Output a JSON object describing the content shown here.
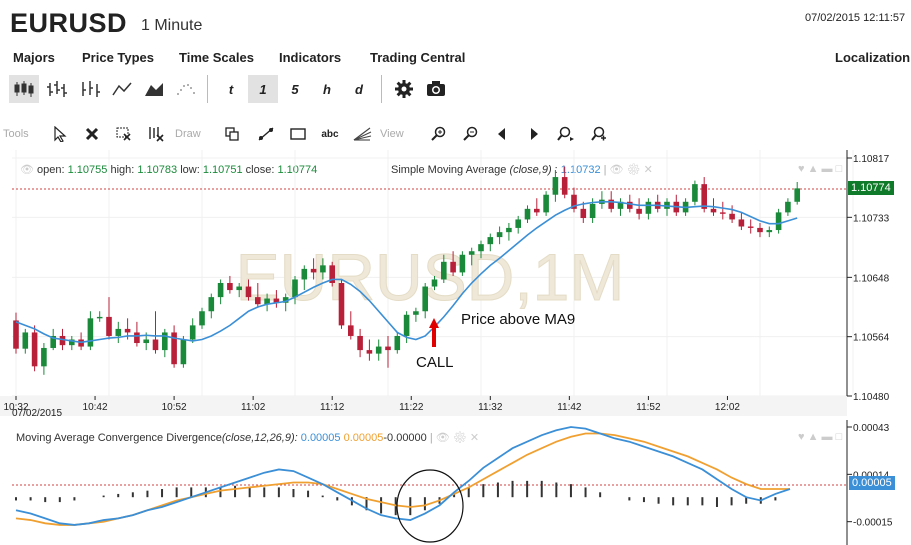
{
  "header": {
    "title": "EURUSD",
    "subtitle": "1 Minute",
    "datetime": "07/02/2015 12:11:57"
  },
  "menu": {
    "items": [
      "Majors",
      "Price Types",
      "Time Scales",
      "Indicators",
      "Trading Central"
    ],
    "right": "Localization"
  },
  "toolbar": {
    "timescales": [
      "t",
      "1",
      "5",
      "h",
      "d"
    ],
    "selected_timescale": "1"
  },
  "tools": {
    "tools_label": "Tools",
    "draw_label": "Draw",
    "view_label": "View",
    "text_tool": "abc"
  },
  "price_chart": {
    "watermark": "EURUSD,1M",
    "ohlc": {
      "open_label": "open:",
      "open": "1.10755",
      "high_label": "high:",
      "high": "1.10783",
      "low_label": "low:",
      "low": "1.10751",
      "close_label": "close:",
      "close": "1.10774"
    },
    "sma_label": "Simple Moving Average",
    "sma_params": "(close,9)",
    "sma_value": "1.10732",
    "current_price": "1.10774",
    "y_ticks": [
      "1.10817",
      "1.10733",
      "1.10648",
      "1.10564",
      "1.10480"
    ],
    "x_ticks": [
      "10:32",
      "10:42",
      "10:52",
      "11:02",
      "11:12",
      "11:22",
      "11:32",
      "11:42",
      "11:52",
      "12:02"
    ],
    "date_label": "07/02/2015",
    "annotation_price_above": "Price above MA9",
    "annotation_call": "CALL",
    "colors": {
      "up": "#1a8a3a",
      "down": "#b8203a",
      "ma": "#3b8fd6"
    }
  },
  "macd": {
    "label": "Moving Average Convergence Divergence",
    "params": "(close,12,26,9):",
    "v1": "0.00005",
    "v2": "0.00005",
    "v3": "-0.00000",
    "y_ticks": [
      "0.00043",
      "0.00014",
      "-0.00015"
    ],
    "current": "0.00005",
    "colors": {
      "macd": "#3b8fd6",
      "signal": "#f0a030",
      "hist": "#333333"
    }
  },
  "chart_data": {
    "type": "candlestick",
    "candles": [
      {
        "o": 1.10587,
        "h": 1.10598,
        "l": 1.1054,
        "c": 1.10547
      },
      {
        "o": 1.10547,
        "h": 1.10575,
        "l": 1.1054,
        "c": 1.1057
      },
      {
        "o": 1.1057,
        "h": 1.1058,
        "l": 1.10515,
        "c": 1.10522
      },
      {
        "o": 1.10522,
        "h": 1.10555,
        "l": 1.1051,
        "c": 1.10548
      },
      {
        "o": 1.10548,
        "h": 1.10575,
        "l": 1.10545,
        "c": 1.10565
      },
      {
        "o": 1.10565,
        "h": 1.10575,
        "l": 1.10545,
        "c": 1.10552
      },
      {
        "o": 1.10552,
        "h": 1.10565,
        "l": 1.10545,
        "c": 1.1056
      },
      {
        "o": 1.1056,
        "h": 1.1057,
        "l": 1.10545,
        "c": 1.1055
      },
      {
        "o": 1.1055,
        "h": 1.106,
        "l": 1.10545,
        "c": 1.1059
      },
      {
        "o": 1.1059,
        "h": 1.106,
        "l": 1.10585,
        "c": 1.10592
      },
      {
        "o": 1.10592,
        "h": 1.1062,
        "l": 1.1056,
        "c": 1.10565
      },
      {
        "o": 1.10565,
        "h": 1.10585,
        "l": 1.10555,
        "c": 1.10575
      },
      {
        "o": 1.10575,
        "h": 1.1059,
        "l": 1.1056,
        "c": 1.1057
      },
      {
        "o": 1.1057,
        "h": 1.10585,
        "l": 1.1055,
        "c": 1.10555
      },
      {
        "o": 1.10555,
        "h": 1.1057,
        "l": 1.10545,
        "c": 1.1056
      },
      {
        "o": 1.1056,
        "h": 1.106,
        "l": 1.1054,
        "c": 1.10545
      },
      {
        "o": 1.10545,
        "h": 1.10575,
        "l": 1.10535,
        "c": 1.1057
      },
      {
        "o": 1.1057,
        "h": 1.1058,
        "l": 1.1052,
        "c": 1.10525
      },
      {
        "o": 1.10525,
        "h": 1.10565,
        "l": 1.1052,
        "c": 1.1056
      },
      {
        "o": 1.1056,
        "h": 1.1059,
        "l": 1.10555,
        "c": 1.1058
      },
      {
        "o": 1.1058,
        "h": 1.10605,
        "l": 1.10575,
        "c": 1.106
      },
      {
        "o": 1.106,
        "h": 1.10625,
        "l": 1.1059,
        "c": 1.1062
      },
      {
        "o": 1.1062,
        "h": 1.10645,
        "l": 1.1061,
        "c": 1.1064
      },
      {
        "o": 1.1064,
        "h": 1.1065,
        "l": 1.10625,
        "c": 1.1063
      },
      {
        "o": 1.1063,
        "h": 1.1064,
        "l": 1.1062,
        "c": 1.10635
      },
      {
        "o": 1.10635,
        "h": 1.10645,
        "l": 1.10615,
        "c": 1.1062
      },
      {
        "o": 1.1062,
        "h": 1.1064,
        "l": 1.10605,
        "c": 1.1061
      },
      {
        "o": 1.1061,
        "h": 1.10625,
        "l": 1.106,
        "c": 1.10618
      },
      {
        "o": 1.10618,
        "h": 1.1063,
        "l": 1.10605,
        "c": 1.10612
      },
      {
        "o": 1.10612,
        "h": 1.10625,
        "l": 1.106,
        "c": 1.1062
      },
      {
        "o": 1.1062,
        "h": 1.1065,
        "l": 1.1061,
        "c": 1.10645
      },
      {
        "o": 1.10645,
        "h": 1.10665,
        "l": 1.1063,
        "c": 1.1066
      },
      {
        "o": 1.1066,
        "h": 1.10675,
        "l": 1.10645,
        "c": 1.10655
      },
      {
        "o": 1.10655,
        "h": 1.10675,
        "l": 1.10645,
        "c": 1.10665
      },
      {
        "o": 1.10665,
        "h": 1.1067,
        "l": 1.10635,
        "c": 1.1064
      },
      {
        "o": 1.1064,
        "h": 1.10645,
        "l": 1.10575,
        "c": 1.1058
      },
      {
        "o": 1.1058,
        "h": 1.106,
        "l": 1.1056,
        "c": 1.10565
      },
      {
        "o": 1.10565,
        "h": 1.10575,
        "l": 1.10535,
        "c": 1.10545
      },
      {
        "o": 1.10545,
        "h": 1.1056,
        "l": 1.1053,
        "c": 1.1054
      },
      {
        "o": 1.1054,
        "h": 1.1056,
        "l": 1.1053,
        "c": 1.1055
      },
      {
        "o": 1.1055,
        "h": 1.10565,
        "l": 1.1052,
        "c": 1.10545
      },
      {
        "o": 1.10545,
        "h": 1.1057,
        "l": 1.1054,
        "c": 1.10565
      },
      {
        "o": 1.10565,
        "h": 1.106,
        "l": 1.10555,
        "c": 1.10595
      },
      {
        "o": 1.10595,
        "h": 1.10605,
        "l": 1.10585,
        "c": 1.106
      },
      {
        "o": 1.106,
        "h": 1.1064,
        "l": 1.1059,
        "c": 1.10635
      },
      {
        "o": 1.10635,
        "h": 1.1065,
        "l": 1.1063,
        "c": 1.10645
      },
      {
        "o": 1.10645,
        "h": 1.1068,
        "l": 1.1064,
        "c": 1.1067
      },
      {
        "o": 1.1067,
        "h": 1.10685,
        "l": 1.1065,
        "c": 1.10655
      },
      {
        "o": 1.10655,
        "h": 1.10685,
        "l": 1.1065,
        "c": 1.1068
      },
      {
        "o": 1.1068,
        "h": 1.1069,
        "l": 1.10665,
        "c": 1.10685
      },
      {
        "o": 1.10685,
        "h": 1.107,
        "l": 1.10675,
        "c": 1.10695
      },
      {
        "o": 1.10695,
        "h": 1.1071,
        "l": 1.10685,
        "c": 1.10705
      },
      {
        "o": 1.10705,
        "h": 1.1072,
        "l": 1.10695,
        "c": 1.10712
      },
      {
        "o": 1.10712,
        "h": 1.10725,
        "l": 1.107,
        "c": 1.10718
      },
      {
        "o": 1.10718,
        "h": 1.10735,
        "l": 1.1071,
        "c": 1.1073
      },
      {
        "o": 1.1073,
        "h": 1.1075,
        "l": 1.10725,
        "c": 1.10745
      },
      {
        "o": 1.10745,
        "h": 1.1076,
        "l": 1.10735,
        "c": 1.1074
      },
      {
        "o": 1.1074,
        "h": 1.1077,
        "l": 1.10735,
        "c": 1.10765
      },
      {
        "o": 1.10765,
        "h": 1.108,
        "l": 1.10755,
        "c": 1.1079
      },
      {
        "o": 1.1079,
        "h": 1.10805,
        "l": 1.1076,
        "c": 1.10765
      },
      {
        "o": 1.10765,
        "h": 1.10775,
        "l": 1.1074,
        "c": 1.10745
      },
      {
        "o": 1.10745,
        "h": 1.10755,
        "l": 1.10725,
        "c": 1.10732
      },
      {
        "o": 1.10732,
        "h": 1.1076,
        "l": 1.10725,
        "c": 1.10752
      },
      {
        "o": 1.10752,
        "h": 1.1077,
        "l": 1.10745,
        "c": 1.10758
      },
      {
        "o": 1.10758,
        "h": 1.1077,
        "l": 1.1074,
        "c": 1.10745
      },
      {
        "o": 1.10745,
        "h": 1.1076,
        "l": 1.10735,
        "c": 1.10755
      },
      {
        "o": 1.10755,
        "h": 1.10765,
        "l": 1.1074,
        "c": 1.10745
      },
      {
        "o": 1.10745,
        "h": 1.1076,
        "l": 1.1073,
        "c": 1.10738
      },
      {
        "o": 1.10738,
        "h": 1.1076,
        "l": 1.1073,
        "c": 1.10755
      },
      {
        "o": 1.10755,
        "h": 1.10765,
        "l": 1.1074,
        "c": 1.10745
      },
      {
        "o": 1.10745,
        "h": 1.1076,
        "l": 1.10735,
        "c": 1.10755
      },
      {
        "o": 1.10755,
        "h": 1.10765,
        "l": 1.10735,
        "c": 1.1074
      },
      {
        "o": 1.1074,
        "h": 1.1076,
        "l": 1.10735,
        "c": 1.10755
      },
      {
        "o": 1.10755,
        "h": 1.10785,
        "l": 1.1075,
        "c": 1.1078
      },
      {
        "o": 1.1078,
        "h": 1.1079,
        "l": 1.1074,
        "c": 1.10745
      },
      {
        "o": 1.10745,
        "h": 1.1076,
        "l": 1.10735,
        "c": 1.1074
      },
      {
        "o": 1.1074,
        "h": 1.10755,
        "l": 1.1073,
        "c": 1.10738
      },
      {
        "o": 1.10738,
        "h": 1.1075,
        "l": 1.10725,
        "c": 1.1073
      },
      {
        "o": 1.1073,
        "h": 1.1074,
        "l": 1.10715,
        "c": 1.1072
      },
      {
        "o": 1.1072,
        "h": 1.1073,
        "l": 1.1071,
        "c": 1.10718
      },
      {
        "o": 1.10718,
        "h": 1.10725,
        "l": 1.10705,
        "c": 1.10712
      },
      {
        "o": 1.10712,
        "h": 1.1072,
        "l": 1.10705,
        "c": 1.10715
      },
      {
        "o": 1.10715,
        "h": 1.10745,
        "l": 1.1071,
        "c": 1.1074
      },
      {
        "o": 1.1074,
        "h": 1.1076,
        "l": 1.10735,
        "c": 1.10755
      },
      {
        "o": 1.10755,
        "h": 1.10783,
        "l": 1.10751,
        "c": 1.10774
      }
    ],
    "sma9": [
      1.10585,
      1.1058,
      1.10575,
      1.10568,
      1.10562,
      1.1056,
      1.10558,
      1.10556,
      1.10558,
      1.1056,
      1.10562,
      1.10563,
      1.10565,
      1.10565,
      1.10566,
      1.10565,
      1.10565,
      1.10562,
      1.1056,
      1.10558,
      1.1056,
      1.10565,
      1.10572,
      1.1058,
      1.1059,
      1.106,
      1.10606,
      1.1061,
      1.10612,
      1.10614,
      1.1062,
      1.10627,
      1.10634,
      1.1064,
      1.10645,
      1.10645,
      1.10638,
      1.10628,
      1.10615,
      1.106,
      1.10585,
      1.1057,
      1.10563,
      1.1056,
      1.10565,
      1.10578,
      1.10592,
      1.10608,
      1.10625,
      1.1064,
      1.10653,
      1.10665,
      1.10675,
      1.10686,
      1.10697,
      1.10708,
      1.10718,
      1.10727,
      1.10736,
      1.10743,
      1.10749,
      1.10752,
      1.10754,
      1.10755,
      1.10755,
      1.10754,
      1.10752,
      1.1075,
      1.1075,
      1.1075,
      1.10749,
      1.10748,
      1.10747,
      1.10748,
      1.10749,
      1.10748,
      1.10746,
      1.10744,
      1.1074,
      1.10734,
      1.10728,
      1.10724,
      1.10724,
      1.10728,
      1.10732
    ],
    "macd": {
      "macd": [
        -8e-05,
        -0.0001,
        -0.00013,
        -0.00016,
        -0.00017,
        -0.00016,
        -0.00014,
        -0.00013,
        -0.00011,
        -8e-05,
        -6e-05,
        -3e-05,
        0.0,
        3e-05,
        6e-05,
        9e-05,
        0.00012,
        0.00015,
        0.00017,
        0.00016,
        0.00012,
        8e-05,
        3e-05,
        -2e-05,
        -7e-05,
        -0.00011,
        -0.00013,
        -0.00014,
        -0.0001,
        -5e-05,
        3e-05,
        0.0001,
        0.00018,
        0.00024,
        0.0003,
        0.00034,
        0.00038,
        0.00041,
        0.00043,
        0.00042,
        0.00039,
        0.00036,
        0.00034,
        0.00031,
        0.00028,
        0.00025,
        0.00021,
        0.00017,
        0.00011,
        5e-05,
        0.0,
        -2e-05,
        2e-05,
        5e-05
      ],
      "signal": [
        -0.00013,
        -0.00014,
        -0.00016,
        -0.00017,
        -0.00017,
        -0.00016,
        -0.00015,
        -0.00013,
        -0.00011,
        -8e-05,
        -5e-05,
        -2e-05,
        0.0,
        2e-05,
        4e-05,
        5e-05,
        6e-05,
        7e-05,
        8e-05,
        9e-05,
        9e-05,
        8e-05,
        5e-05,
        2e-05,
        -1e-05,
        -3e-05,
        -5e-05,
        -6e-05,
        -5e-05,
        -2e-05,
        2e-05,
        6e-05,
        0.00011,
        0.00016,
        0.00021,
        0.00026,
        0.0003,
        0.00034,
        0.00037,
        0.00039,
        0.00039,
        0.00038,
        0.00036,
        0.00034,
        0.00031,
        0.00028,
        0.00025,
        0.00021,
        0.00017,
        0.00012,
        8e-05,
        5e-05,
        5e-05,
        5e-05
      ],
      "hist": [
        -2e-05,
        -2e-05,
        -3e-05,
        -3e-05,
        -2e-05,
        0.0,
        1e-05,
        2e-05,
        3e-05,
        4e-05,
        5e-05,
        6e-05,
        6e-05,
        6e-05,
        6e-05,
        7e-05,
        6e-05,
        6e-05,
        6e-05,
        5e-05,
        4e-05,
        1e-05,
        -2e-05,
        -5e-05,
        -8e-05,
        -0.0001,
        -0.00011,
        -0.00011,
        -8e-05,
        -4e-05,
        2e-05,
        6e-05,
        8e-05,
        9e-05,
        0.0001,
        0.0001,
        0.0001,
        9e-05,
        8e-05,
        6e-05,
        3e-05,
        0.0,
        -2e-05,
        -3e-05,
        -4e-05,
        -5e-05,
        -5e-05,
        -5e-05,
        -6e-05,
        -5e-05,
        -4e-05,
        -4e-05,
        -2e-05,
        0.0
      ]
    }
  }
}
